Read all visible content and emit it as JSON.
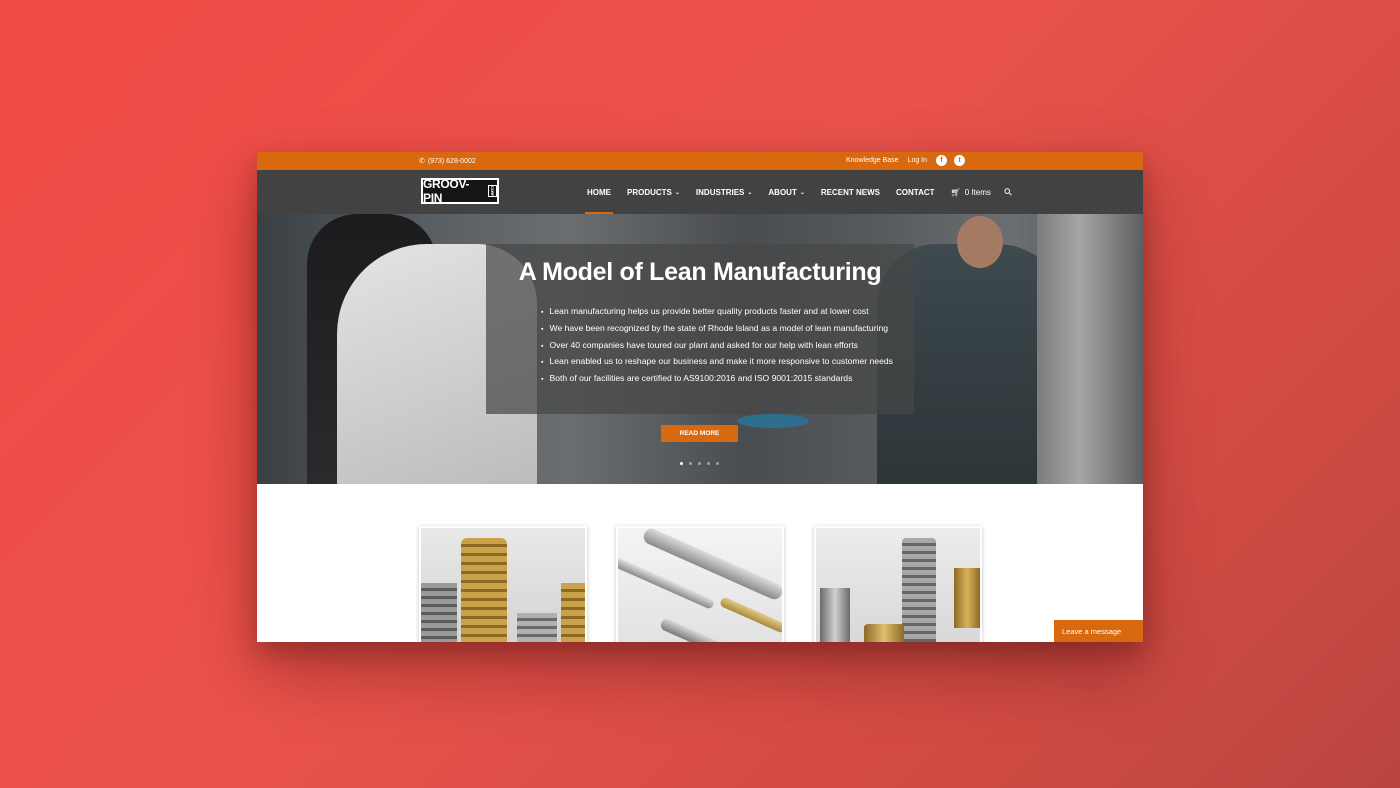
{
  "topbar": {
    "phone": "(973) 628-0002",
    "links": [
      "Knowledge Base",
      "Log In"
    ],
    "social": [
      "facebook-icon",
      "twitter-icon"
    ]
  },
  "logo": {
    "text": "GROOV-PIN",
    "corp": "CORP"
  },
  "nav": {
    "items": [
      {
        "label": "HOME",
        "active": true,
        "dropdown": false
      },
      {
        "label": "PRODUCTS",
        "dropdown": true
      },
      {
        "label": "INDUSTRIES",
        "dropdown": true
      },
      {
        "label": "ABOUT",
        "dropdown": true
      },
      {
        "label": "RECENT NEWS",
        "dropdown": false
      },
      {
        "label": "CONTACT",
        "dropdown": false
      }
    ],
    "cart_label": "0 Items"
  },
  "hero": {
    "title": "A Model of Lean Manufacturing",
    "bullets": [
      "Lean manufacturing helps us provide better quality products faster and at lower cost",
      "We have been recognized by the state of Rhode Island as a model of lean manufacturing",
      "Over 40 companies have toured our plant and asked for our help with lean efforts",
      "Lean enabled us to reshape our business and make it more responsive to customer needs",
      "Both of our facilities are certified to AS9100:2016 and ISO 9001:2015 standards"
    ],
    "button": "READ MORE",
    "slides_total": 5,
    "slide_active": 1
  },
  "chat": {
    "label": "Leave a message"
  },
  "colors": {
    "accent": "#d9690f",
    "nav_bg": "#424242",
    "background": "#ef4a44"
  }
}
